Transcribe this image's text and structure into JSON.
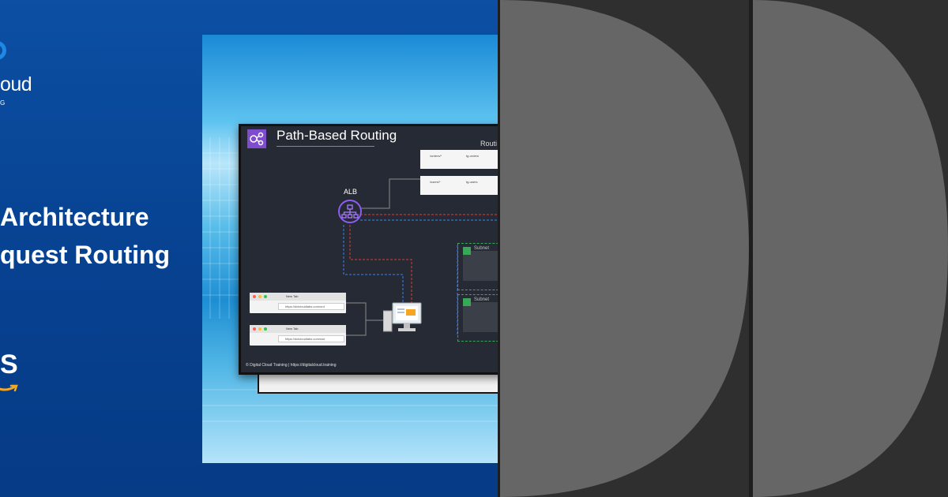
{
  "hero": {
    "logo_text": "oud",
    "logo_subtext": "G",
    "headline_line1": "Architecture",
    "headline_line2": "quest Routing",
    "aws_text": "S",
    "colors": {
      "background": "#0a4a9c",
      "accent": "#f5a623",
      "logo_blue": "#1e88e5"
    }
  },
  "screenshot": {
    "slide_title": "Path-Based Routing",
    "routing_label": "Routi",
    "alb_label": "ALB",
    "routing_rows": [
      {
        "path": "/orders/*",
        "target": "tg-orders"
      },
      {
        "path": "/users/*",
        "target": "tg-users"
      }
    ],
    "subnets": [
      "Subnet",
      "Subnet"
    ],
    "browsers": [
      {
        "tab": "New Tab",
        "url": "https://dctcloudlabs.com/ord"
      },
      {
        "tab": "New Tab",
        "url": "https://dctcloudlabs.com/use"
      }
    ],
    "footer": "© Digital Cloud Training  |  https://digitalcloud.training",
    "icons": [
      "alb-icon",
      "client-computer-icon",
      "subnet-icon",
      "slide-icon"
    ]
  },
  "placeholders": {
    "count": 2,
    "colors": {
      "background": "#2f2f2f",
      "shape": "#666666",
      "divider": "#ffffff"
    }
  }
}
